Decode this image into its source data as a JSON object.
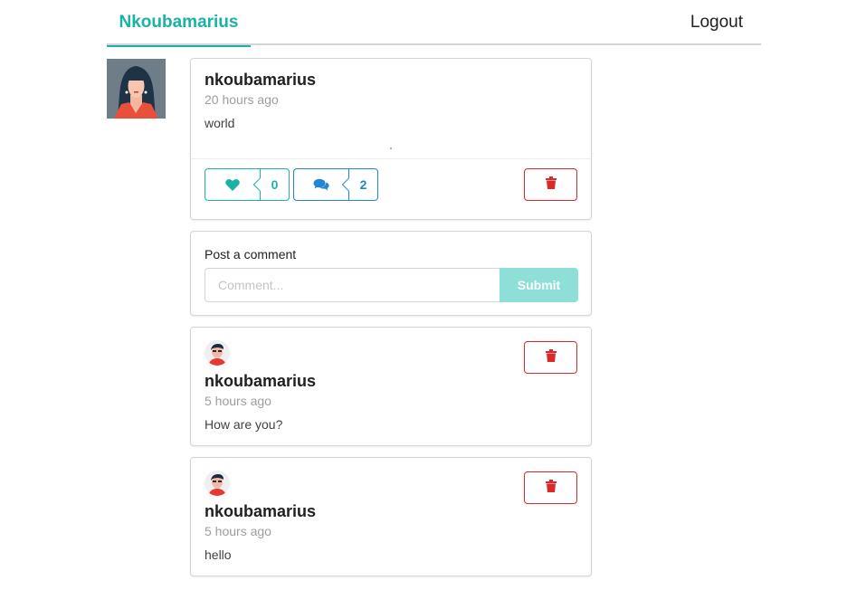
{
  "menu": {
    "brand": "Nkoubamarius",
    "logout_label": "Logout"
  },
  "post": {
    "author": "nkoubamarius",
    "time": "20 hours ago",
    "body": "world",
    "likes": "0",
    "comments": "2",
    "icons": {
      "like": "heart-icon",
      "comment": "comments-icon",
      "delete": "trash-icon"
    }
  },
  "comment_form": {
    "label": "Post a comment",
    "placeholder": "Comment...",
    "submit_label": "Submit"
  },
  "comments": [
    {
      "author": "nkoubamarius",
      "time": "5 hours ago",
      "body": "How are you?"
    },
    {
      "author": "nkoubamarius",
      "time": "5 hours ago",
      "body": "hello"
    }
  ],
  "colors": {
    "teal": "#1ab2a6",
    "blue": "#2185d0",
    "red": "#db2828",
    "submit_disabled": "#8ddfd8"
  }
}
